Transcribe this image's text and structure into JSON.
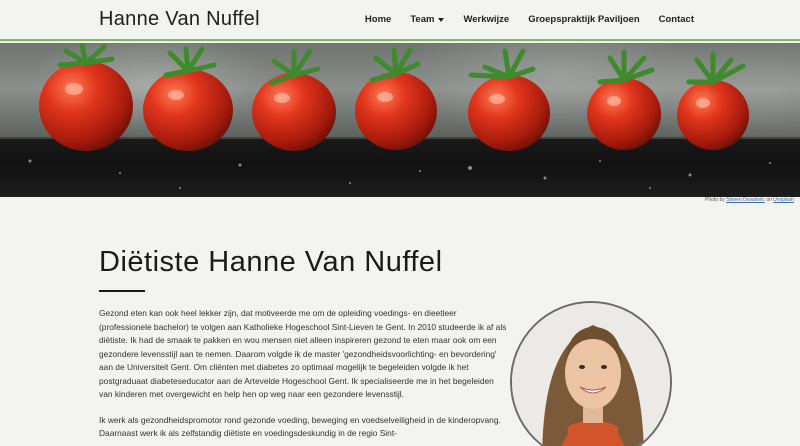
{
  "header": {
    "brand": "Hanne Van Nuffel",
    "nav": [
      {
        "label": "Home"
      },
      {
        "label": "Team",
        "has_dropdown": true
      },
      {
        "label": "Werkwijze"
      },
      {
        "label": "Groepspraktijk Paviljoen"
      },
      {
        "label": "Contact"
      }
    ],
    "accent_color": "#7bb661"
  },
  "hero": {
    "credit_prefix": "Photo by",
    "credit_author": "Steven Duvalovic",
    "credit_on": "on",
    "credit_site": "Unsplash"
  },
  "main": {
    "title": "Diëtiste Hanne Van Nuffel",
    "paragraphs": [
      "Gezond eten kan ook heel lekker zijn, dat motiveerde me om de opleiding voedings- en dieetleer (professionele bachelor) te volgen aan Katholieke Hogeschool Sint-Lieven te Gent. In 2010 studeerde ik af als diëtiste. Ik had de smaak te pakken en wou mensen niet alleen inspireren gezond te eten maar ook om een gezondere levensstijl aan te nemen. Daarom volgde ik de master 'gezondheidsvoorlichting- en bevordering' aan de Universiteit Gent. Om cliënten met diabetes zo optimaal mogelijk te begeleiden volgde ik het postgraduaat diabeteseducator aan de Artevelde Hogeschool Gent. Ik specialiseerde me in het begeleiden van kinderen met overgewicht en help hen op weg naar een gezondere levensstijl.",
      "Ik werk als gezondheidspromotor rond gezonde voeding, beweging en voedselveiligheid in de kinderopvang. Daarnaast werk ik als zelfstandig diëtiste en voedingsdeskundig in de regio Sint-"
    ]
  }
}
